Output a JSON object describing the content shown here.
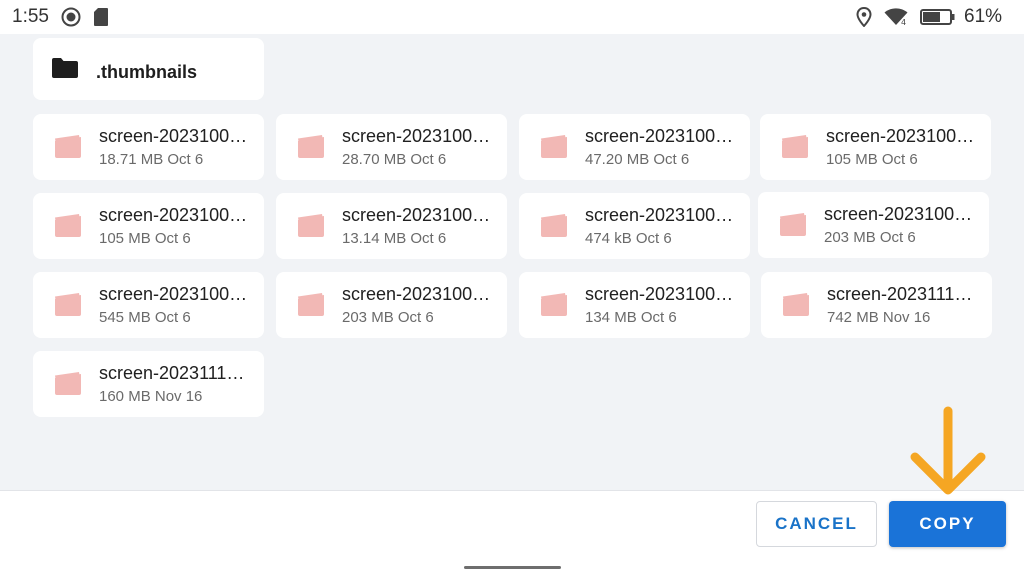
{
  "status_bar": {
    "time": "1:55",
    "battery_percent": "61%",
    "icons": [
      "record-icon",
      "sd-card-icon",
      "location-icon",
      "wifi-icon",
      "battery-icon"
    ]
  },
  "folder": {
    "name": ".thumbnails",
    "icon": "folder-icon"
  },
  "files": [
    {
      "name": "screen-2023100…",
      "meta": "18.71 MB Oct 6"
    },
    {
      "name": "screen-2023100…",
      "meta": "28.70 MB Oct 6"
    },
    {
      "name": "screen-2023100…",
      "meta": "47.20 MB Oct 6"
    },
    {
      "name": "screen-2023100…",
      "meta": "105 MB Oct 6"
    },
    {
      "name": "screen-2023100…",
      "meta": "105 MB Oct 6"
    },
    {
      "name": "screen-2023100…",
      "meta": "13.14 MB Oct 6"
    },
    {
      "name": "screen-2023100…",
      "meta": "474 kB Oct 6"
    },
    {
      "name": "screen-2023100…",
      "meta": "203 MB Oct 6"
    },
    {
      "name": "screen-2023100…",
      "meta": "545 MB Oct 6"
    },
    {
      "name": "screen-2023100…",
      "meta": "203 MB Oct 6"
    },
    {
      "name": "screen-2023100…",
      "meta": "134 MB Oct 6"
    },
    {
      "name": "screen-2023111…",
      "meta": "742 MB Nov 16"
    },
    {
      "name": "screen-2023111…",
      "meta": "160 MB Nov 16"
    }
  ],
  "actions": {
    "cancel_label": "CANCEL",
    "copy_label": "COPY"
  },
  "colors": {
    "accent": "#1a73d8",
    "video_icon": "#f2b8b5",
    "annotation_arrow": "#f5a623"
  }
}
